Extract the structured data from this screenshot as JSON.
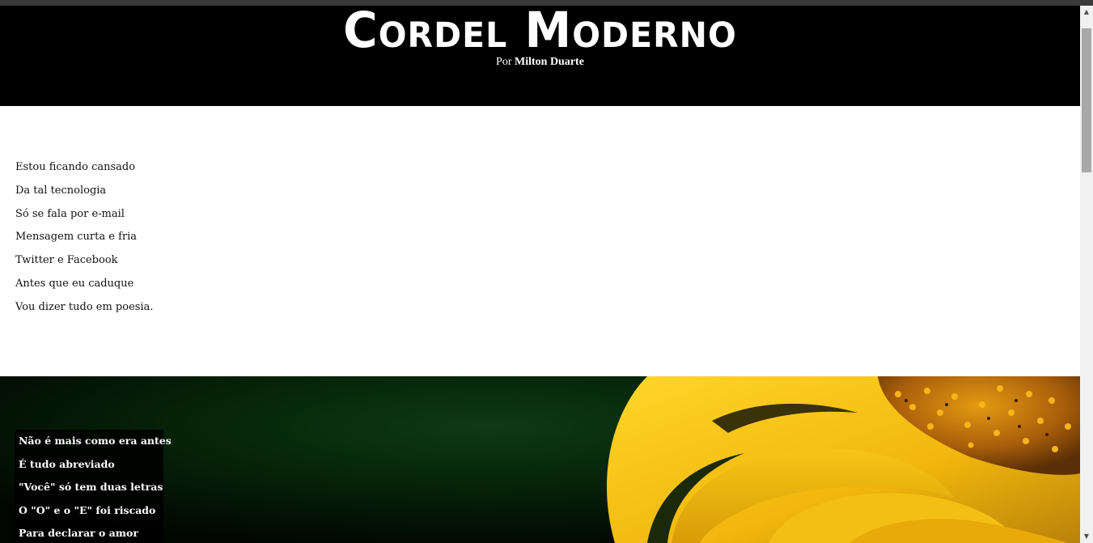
{
  "header": {
    "title": "Cordel Moderno",
    "byline_prefix": "Por",
    "author": "Milton Duarte"
  },
  "verses_1": [
    "Estou ficando cansado",
    "Da tal tecnologia",
    "Só se fala por e-mail",
    "Mensagem curta e fria",
    "Twitter e Facebook",
    "Antes que eu caduque",
    "Vou dizer tudo em poesia."
  ],
  "verses_2": [
    "Não é mais como era antes",
    "É tudo abreviado",
    "\"Você\" só tem duas letras",
    "O \"O\" e o \"E\" foi riscado",
    "Para declarar o amor"
  ],
  "colors": {
    "header_bg": "#000000",
    "flower_yellow": "#f5c518",
    "leaf_dark_green": "#062409"
  },
  "scrollbar": {
    "up_icon": "scroll-up-arrow-icon",
    "down_icon": "scroll-down-arrow-icon"
  }
}
